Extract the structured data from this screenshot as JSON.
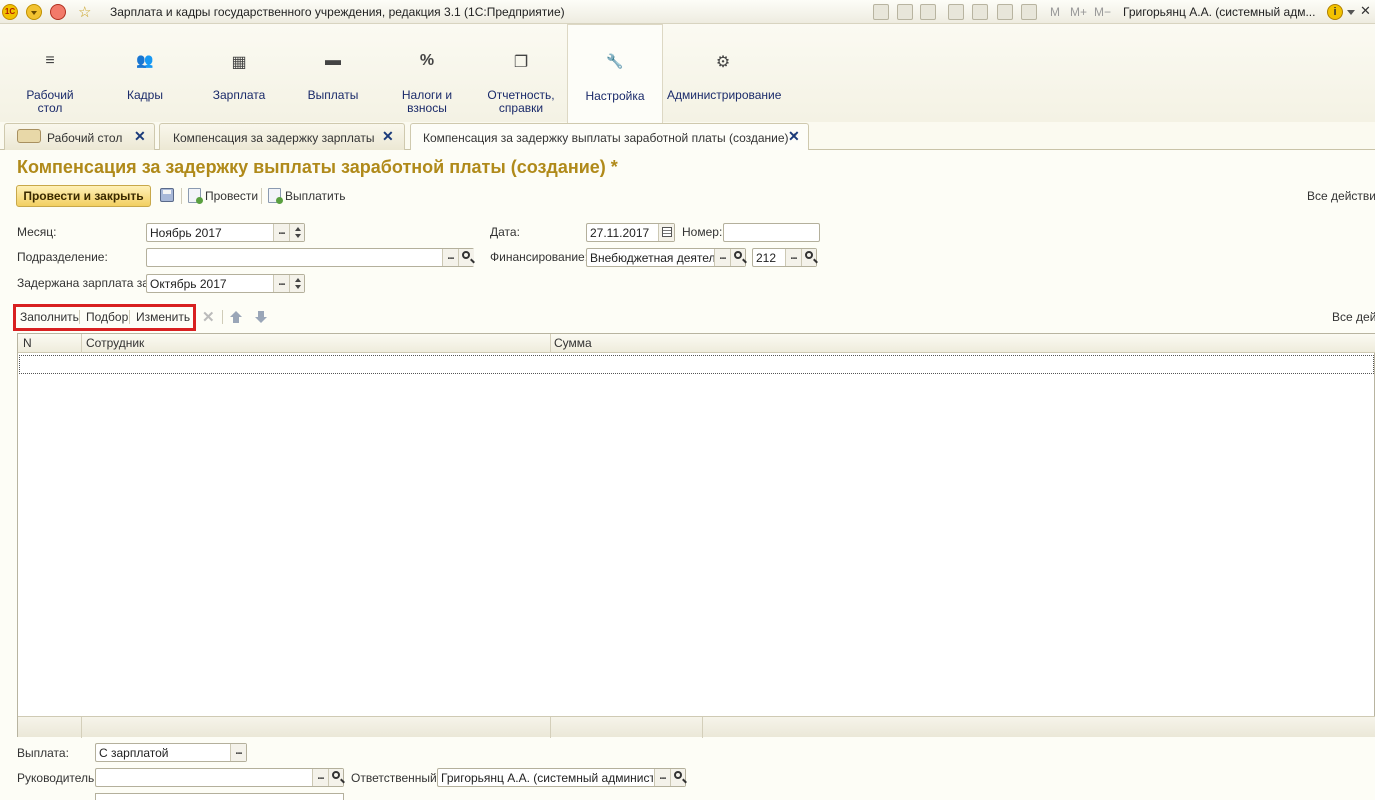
{
  "window": {
    "logo": "1C",
    "title": "Зарплата и кадры государственного учреждения, редакция 3.1  (1С:Предприятие)",
    "memory_buttons": [
      "M",
      "M+",
      "M−"
    ],
    "user": "Григорьянц А.А. (системный адм...",
    "info": "i",
    "close": "✕"
  },
  "sections": [
    {
      "icon": "desktop-icon",
      "glyph": "≡",
      "label": "Рабочий стол"
    },
    {
      "icon": "people-icon",
      "glyph": "👥",
      "label": "Кадры"
    },
    {
      "icon": "calculator-icon",
      "glyph": "▦",
      "label": "Зарплата"
    },
    {
      "icon": "wallet-icon",
      "glyph": "▬",
      "label": "Выплаты"
    },
    {
      "icon": "percent-icon",
      "glyph": "%",
      "label": "Налоги и взносы"
    },
    {
      "icon": "reports-icon",
      "glyph": "❐",
      "label": "Отчетность, справки"
    },
    {
      "icon": "wrench-icon",
      "glyph": "🔧",
      "label": "Настройка"
    },
    {
      "icon": "gear-icon",
      "glyph": "⚙",
      "label": "Администрирование"
    }
  ],
  "tabs": [
    {
      "label": "Рабочий стол",
      "close": "✕"
    },
    {
      "label": "Компенсация за задержку зарплаты",
      "close": "✕"
    },
    {
      "label": "Компенсация за задержку выплаты заработной платы (создание) *",
      "close": "✕"
    }
  ],
  "form": {
    "title": "Компенсация за задержку выплаты заработной платы (создание) *",
    "toolbar": {
      "post_and_close": "Провести и закрыть",
      "post": "Провести",
      "pay": "Выплатить",
      "all_actions": "Все действия"
    },
    "fields": {
      "month_label": "Месяц:",
      "month_value": "Ноябрь 2017",
      "date_label": "Дата:",
      "date_value": "27.11.2017",
      "number_label": "Номер:",
      "number_value": "",
      "department_label": "Подразделение:",
      "department_value": "",
      "financing_label": "Финансирование:",
      "financing_value": "Внебюджетная деятельн",
      "financing_code": "212",
      "delayed_label": "Задержана зарплата за:",
      "delayed_value": "Октябрь 2017"
    },
    "table_toolbar": {
      "fill": "Заполнить",
      "pick": "Подбор",
      "change": "Изменить",
      "all_actions": "Все дейс"
    },
    "table": {
      "columns": [
        "N",
        "Сотрудник",
        "Сумма"
      ]
    },
    "bottom": {
      "payment_label": "Выплата:",
      "payment_value": "С зарплатой",
      "head_label": "Руководитель:",
      "head_value": "",
      "responsible_label": "Ответственный:",
      "responsible_value": "Григорьянц А.А. (системный администрат"
    },
    "select_glyph": "...",
    "delete_glyph": "✕"
  }
}
